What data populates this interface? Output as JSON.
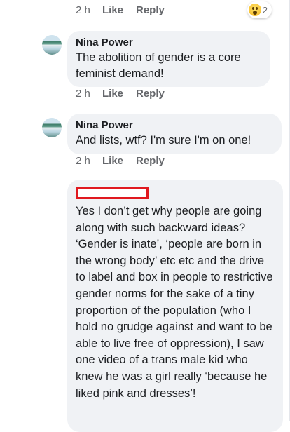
{
  "comments": [
    {
      "time": "2 h",
      "like": "Like",
      "reply": "Reply",
      "reaction": {
        "icon": "wow-emoji-icon",
        "count": "2"
      }
    },
    {
      "author": "Nina Power",
      "text": "The abolition of gender is a core feminist demand!",
      "time": "2 h",
      "like": "Like",
      "reply": "Reply"
    },
    {
      "author": "Nina Power",
      "text": "And lists, wtf? I'm sure I'm on one!",
      "time": "2 h",
      "like": "Like",
      "reply": "Reply"
    },
    {
      "author_redacted": true,
      "text": "Yes I don’t get why people are going along with such backward ideas? ‘Gender is inate’, ‘people are born in the wrong body’ etc etc and the drive to label and box in people to restrictive gender norms for the sake of a tiny proportion of the population (who I hold no grudge against and want to be able to live free of oppression), I saw one video of a trans male kid who knew he was a girl really ‘because he liked pink and dresses’!"
    }
  ],
  "colors": {
    "bubble": "#f0f2f5",
    "meta": "#65676b",
    "redact": "#e0191f"
  }
}
